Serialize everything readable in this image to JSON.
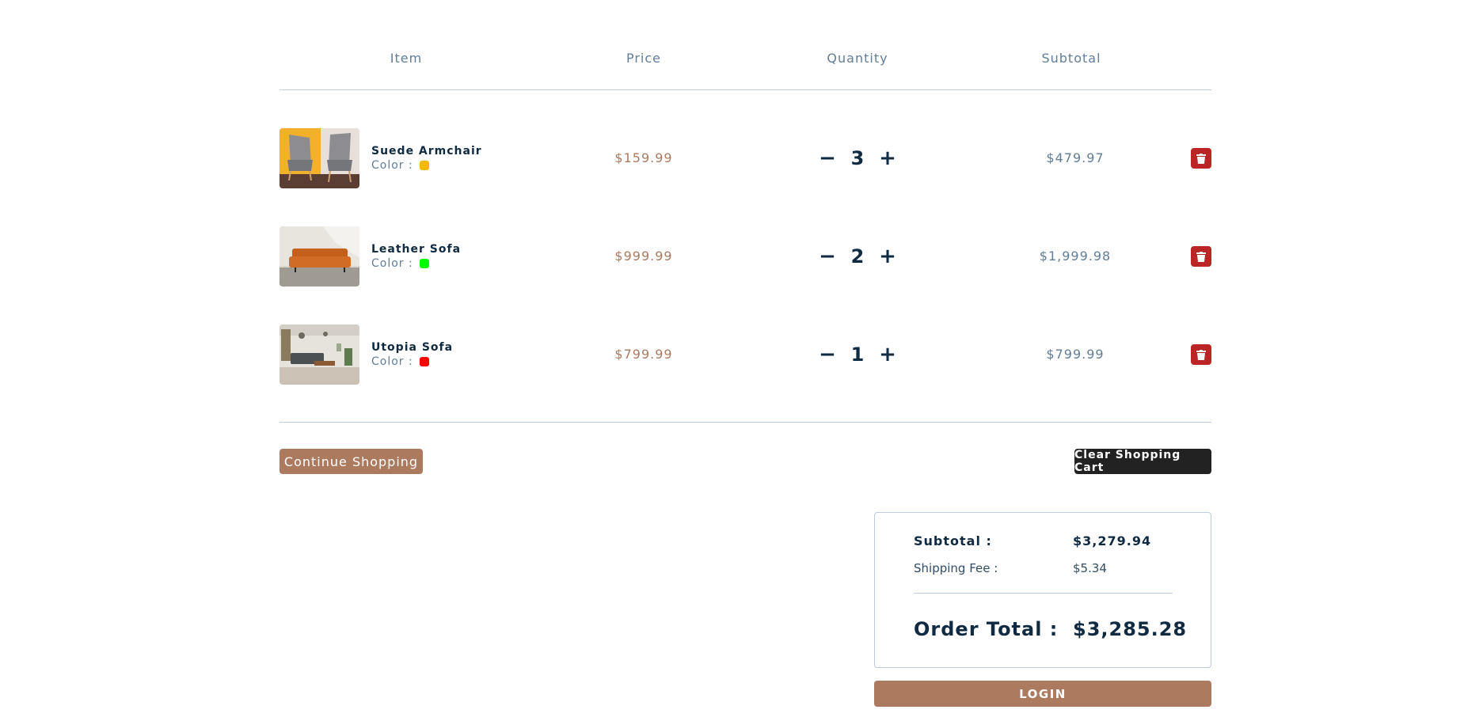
{
  "columns": {
    "item": "Item",
    "price": "Price",
    "quantity": "Quantity",
    "subtotal": "Subtotal"
  },
  "items": [
    {
      "name": "Suede Armchair",
      "color_label": "Color :",
      "color": "#f5b800",
      "price": "$159.99",
      "quantity": "3",
      "subtotal": "$479.97",
      "image": "armchair-photo"
    },
    {
      "name": "Leather Sofa",
      "color_label": "Color :",
      "color": "#00ff00",
      "price": "$999.99",
      "quantity": "2",
      "subtotal": "$1,999.98",
      "image": "leather-sofa-photo"
    },
    {
      "name": "Utopia Sofa",
      "color_label": "Color :",
      "color": "#ff0000",
      "price": "$799.99",
      "quantity": "1",
      "subtotal": "$799.99",
      "image": "utopia-sofa-photo"
    }
  ],
  "qty_controls": {
    "decrease": "−",
    "increase": "+"
  },
  "icons": {
    "delete": "trash-icon"
  },
  "buttons": {
    "continue": "Continue Shopping",
    "clear": "Clear Shopping Cart",
    "login": "LOGIN"
  },
  "totals": {
    "subtotal_label": "Subtotal :",
    "subtotal_value": "$3,279.94",
    "shipping_label": "Shipping Fee :",
    "shipping_value": "$5.34",
    "order_label": "Order Total :",
    "order_value": "$3,285.28"
  },
  "colors": {
    "accent": "#ab7a5f",
    "danger": "#bb2525",
    "dark": "#222222",
    "text_primary": "#102a42",
    "text_muted": "#617d98"
  }
}
